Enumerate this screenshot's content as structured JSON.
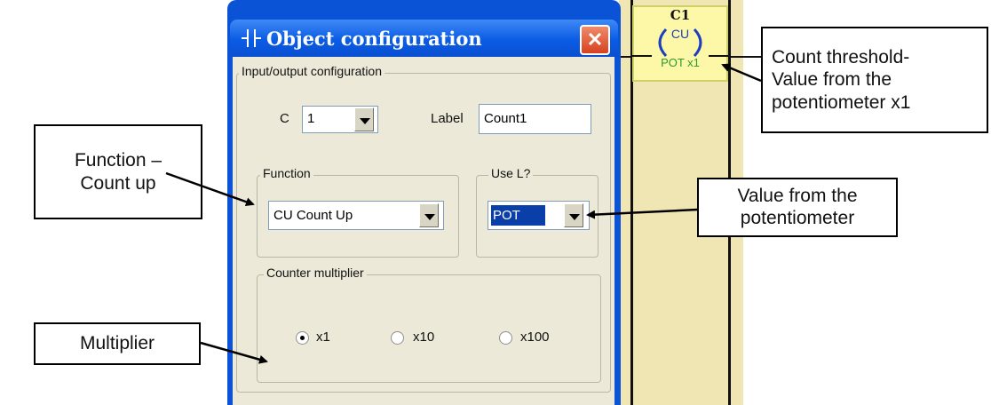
{
  "coil": {
    "title": "C1",
    "symbol": "CU",
    "tag": "POT x1"
  },
  "dialog": {
    "title": "Object configuration",
    "close_icon": "close-icon",
    "io_group": {
      "legend": "Input/output configuration",
      "c_label": "C",
      "c_value": "1",
      "label_caption": "Label",
      "label_value": "Count1"
    },
    "function_group": {
      "legend": "Function",
      "value": "CU Count Up"
    },
    "use_l_group": {
      "legend": "Use L?",
      "value": "POT"
    },
    "multiplier_group": {
      "legend": "Counter multiplier",
      "options": [
        {
          "label": "x1",
          "selected": true
        },
        {
          "label": "x10",
          "selected": false
        },
        {
          "label": "x100",
          "selected": false
        }
      ]
    }
  },
  "callouts": {
    "function": {
      "line1": "Function –",
      "line2": "Count up"
    },
    "multiplier": "Multiplier",
    "threshold": {
      "line1": "Count threshold-",
      "line2": "Value from the",
      "line3": "potentiometer x1"
    },
    "pot_value": {
      "line1": "Value from the",
      "line2": "potentiometer"
    }
  },
  "colors": {
    "titlebar": "#0b5ce5",
    "dialog_bg": "#ece9d8",
    "coil_tag": "#2a9a2a",
    "ladder_bg": "#f0e6b4"
  }
}
